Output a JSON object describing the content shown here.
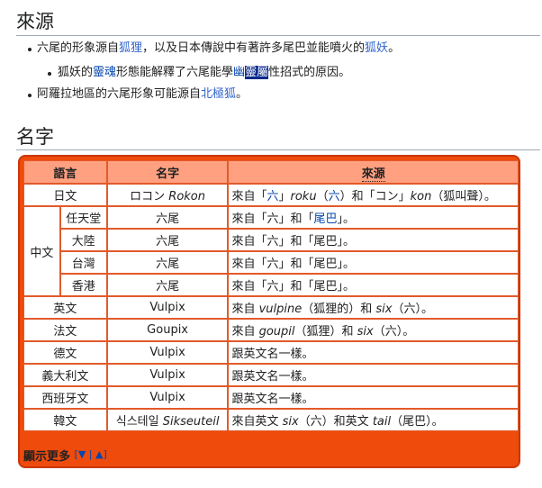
{
  "section1": {
    "heading": "來源",
    "bullets": [
      {
        "level": 1,
        "parts": [
          {
            "text": "六尾的形象源自"
          },
          {
            "text": "狐狸",
            "link": true
          },
          {
            "text": "，以及日本傳說中有著許多尾巴並能噴火的"
          },
          {
            "text": "狐妖",
            "link": true
          },
          {
            "text": "。"
          }
        ]
      },
      {
        "level": 2,
        "parts": [
          {
            "text": "狐妖的"
          },
          {
            "text": "靈魂",
            "link": true
          },
          {
            "text": "形態能解釋了六尾能學"
          },
          {
            "text": "幽靈屬",
            "link": true,
            "selected_part": "靈屬"
          },
          {
            "text": "性招式的原因。"
          }
        ]
      },
      {
        "level": 1,
        "parts": [
          {
            "text": "阿羅拉地區的六尾形象可能源自"
          },
          {
            "text": "北極狐",
            "link": true
          },
          {
            "text": "。"
          }
        ]
      }
    ]
  },
  "section2": {
    "heading": "名字",
    "table": {
      "headers": [
        "語言",
        "名字",
        "來源"
      ],
      "rows": [
        {
          "lang": "日文",
          "name": "ロコン Rokon",
          "origin": "來自「六」roku（六）和「コン」kon（狐叫聲）。"
        },
        {
          "lang": "中文",
          "sub": "任天堂",
          "name": "六尾",
          "origin": "來自「六」和「尾巴」。"
        },
        {
          "lang": "中文",
          "sub": "大陸",
          "name": "六尾",
          "origin": "來自「六」和「尾巴」。"
        },
        {
          "lang": "中文",
          "sub": "台灣",
          "name": "六尾",
          "origin": "來自「六」和「尾巴」。"
        },
        {
          "lang": "中文",
          "sub": "香港",
          "name": "六尾",
          "origin": "來自「六」和「尾巴」。"
        },
        {
          "lang": "英文",
          "name": "Vulpix",
          "origin": "來自 vulpine（狐狸的）和 six（六）。"
        },
        {
          "lang": "法文",
          "name": "Goupix",
          "origin": "來自 goupil（狐狸）和 six（六）。"
        },
        {
          "lang": "德文",
          "name": "Vulpix",
          "origin": "跟英文名一樣。"
        },
        {
          "lang": "義大利文",
          "name": "Vulpix",
          "origin": "跟英文名一樣。"
        },
        {
          "lang": "西班牙文",
          "name": "Vulpix",
          "origin": "跟英文名一樣。"
        },
        {
          "lang": "韓文",
          "name": "식스테일 Sikseuteil",
          "origin": "來自英文 six（六）和英文 tail（尾巴）。"
        }
      ],
      "footer": {
        "label": "顯示更多",
        "down": "▼",
        "up": "▲"
      }
    }
  },
  "colors": {
    "table_border": "#ee4b0c",
    "header_bg": "#ffa080",
    "link": "#3366cc",
    "selection": "#0a2a8c"
  }
}
